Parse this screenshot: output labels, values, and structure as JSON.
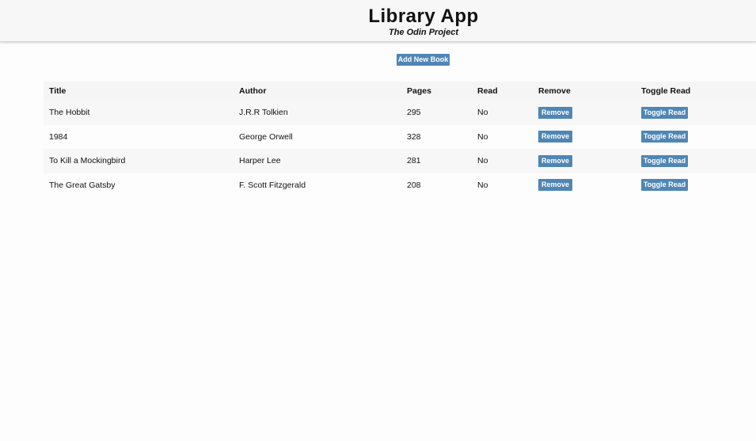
{
  "header": {
    "title": "Library App",
    "subtitle": "The Odin Project"
  },
  "toolbar": {
    "add_label": "Add New Book"
  },
  "table": {
    "columns": [
      "Title",
      "Author",
      "Pages",
      "Read",
      "Remove",
      "Toggle Read"
    ],
    "rows": [
      {
        "title": "The Hobbit",
        "author": "J.R.R Tolkien",
        "pages": "295",
        "read": "No",
        "remove_label": "Remove",
        "toggle_label": "Toggle Read"
      },
      {
        "title": "1984",
        "author": "George Orwell",
        "pages": "328",
        "read": "No",
        "remove_label": "Remove",
        "toggle_label": "Toggle Read"
      },
      {
        "title": "To Kill a Mockingbird",
        "author": "Harper Lee",
        "pages": "281",
        "read": "No",
        "remove_label": "Remove",
        "toggle_label": "Toggle Read"
      },
      {
        "title": "The Great Gatsby",
        "author": "F. Scott Fitzgerald",
        "pages": "208",
        "read": "No",
        "remove_label": "Remove",
        "toggle_label": "Toggle Read"
      }
    ]
  },
  "colors": {
    "button_bg": "#4f86b6",
    "button_text": "#ffffff",
    "header_bg": "#f7f7f7",
    "row_stripe": "#f7f7f7"
  }
}
